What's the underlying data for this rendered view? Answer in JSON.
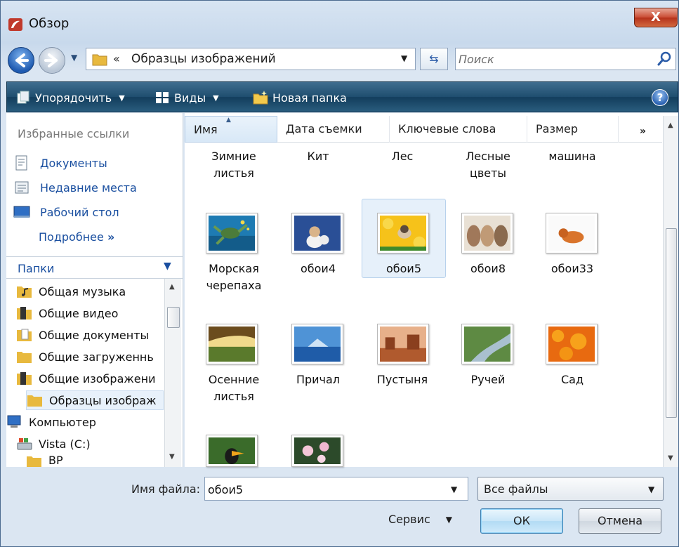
{
  "window": {
    "title": "Обзор",
    "close_label": "X"
  },
  "address": {
    "path": "Образцы изображений",
    "chevron": "«"
  },
  "search": {
    "placeholder": "Поиск"
  },
  "toolbar": {
    "organize": "Упорядочить",
    "views": "Виды",
    "new_folder": "Новая папка",
    "help": "?"
  },
  "favorites": {
    "title": "Избранные ссылки",
    "items": [
      "Документы",
      "Недавние места",
      "Рабочий стол"
    ],
    "more": "Подробнее",
    "more_arrow": "»"
  },
  "folders": {
    "title": "Папки",
    "items": [
      "Общая музыка",
      "Общие видео",
      "Общие документы",
      "Общие загруженнь",
      "Общие изображени",
      "Образцы изображ",
      "Компьютер",
      "Vista (C:)",
      "BP"
    ]
  },
  "columns": [
    "Имя",
    "Дата съемки",
    "Ключевые слова",
    "Размер"
  ],
  "columns_more": "»",
  "files": {
    "row0": [
      "Зимние листья",
      "Кит",
      "Лес",
      "Лесные цветы",
      "машина"
    ],
    "row1": [
      "Морская черепаха",
      "обои4",
      "обои5",
      "обои8",
      "обои33"
    ],
    "row2": [
      "Осенние листья",
      "Причал",
      "Пустыня",
      "Ручей",
      "Сад"
    ]
  },
  "selected_file": "обои5",
  "bottom": {
    "filename_label": "Имя файла:",
    "filename_value": "обои5",
    "filetype": "Все файлы",
    "service": "Сервис",
    "ok": "ОК",
    "cancel": "Отмена"
  },
  "colors": {
    "toolbar": "#1f4e6f",
    "link": "#1a4fa0",
    "close": "#c94a32",
    "selection": "#e6f0fa"
  }
}
